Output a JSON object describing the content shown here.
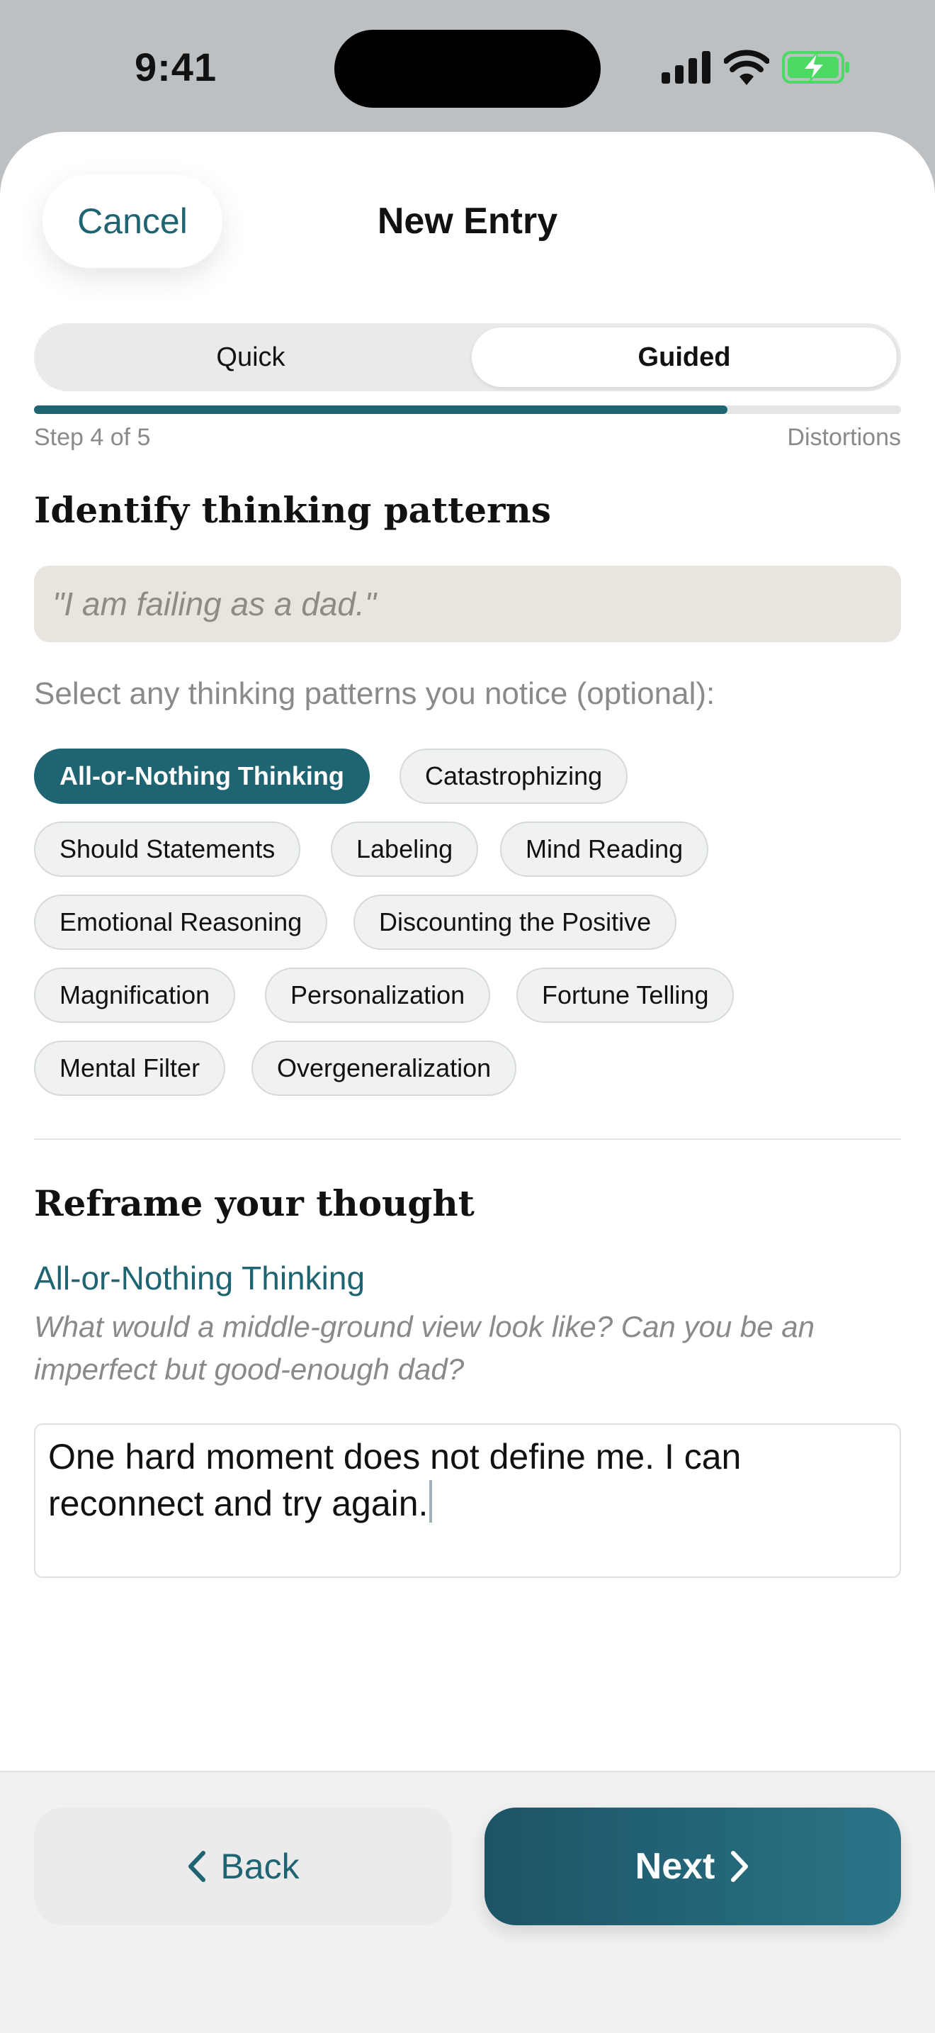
{
  "status_bar": {
    "time": "9:41"
  },
  "header": {
    "cancel_label": "Cancel",
    "title": "New Entry"
  },
  "mode_toggle": {
    "options": [
      "Quick",
      "Guided"
    ],
    "selected": "Guided"
  },
  "progress": {
    "step_label": "Step 4 of 5",
    "step_name": "Distortions",
    "fraction": 0.8
  },
  "identify": {
    "title": "Identify thinking patterns",
    "thought": "\"I am failing as a dad.\"",
    "instruction": "Select any thinking patterns you notice (optional):"
  },
  "patterns": [
    {
      "label": "All-or-Nothing Thinking",
      "selected": true
    },
    {
      "label": "Catastrophizing",
      "selected": false
    },
    {
      "label": "Should Statements",
      "selected": false
    },
    {
      "label": "Labeling",
      "selected": false
    },
    {
      "label": "Mind Reading",
      "selected": false
    },
    {
      "label": "Emotional Reasoning",
      "selected": false
    },
    {
      "label": "Discounting the Positive",
      "selected": false
    },
    {
      "label": "Magnification",
      "selected": false
    },
    {
      "label": "Personalization",
      "selected": false
    },
    {
      "label": "Fortune Telling",
      "selected": false
    },
    {
      "label": "Mental Filter",
      "selected": false
    },
    {
      "label": "Overgeneralization",
      "selected": false
    }
  ],
  "reframe": {
    "title": "Reframe your thought",
    "pattern_label": "All-or-Nothing Thinking",
    "prompt": "What would a middle-ground view look like? Can you be an imperfect but good-enough dad?",
    "response_line1": "One hard moment does not define me. I can",
    "response_line2": "reconnect and try again."
  },
  "footer": {
    "back_label": "Back",
    "next_label": "Next"
  },
  "colors": {
    "accent": "#1f6472",
    "chip_bg": "#f0f1f1",
    "quote_bg": "#e8e5df",
    "battery": "#4cd964"
  },
  "icons": [
    "signal-icon",
    "wifi-icon",
    "battery-charging-icon",
    "chevron-left-icon",
    "chevron-right-icon"
  ]
}
